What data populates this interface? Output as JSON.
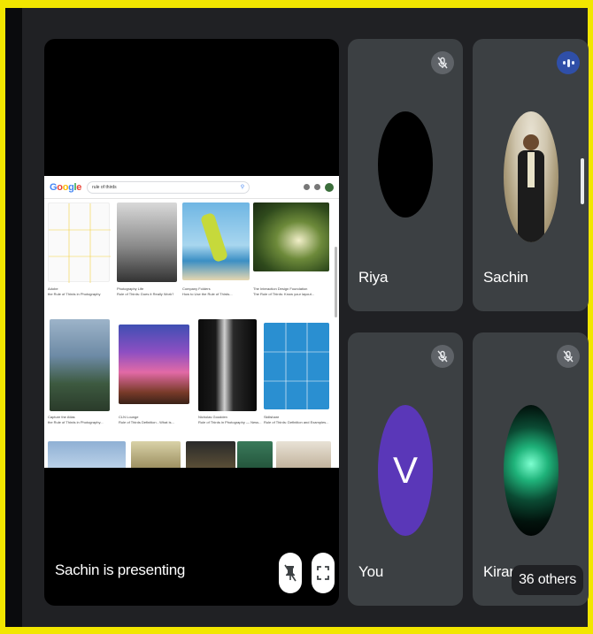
{
  "presenter_tile": {
    "caption": "Sachin is presenting",
    "unpin_icon": "pin-off-icon",
    "fullscreen_icon": "fullscreen-icon",
    "shared_screen": {
      "search_query": "rule of thirds",
      "logo": [
        "G",
        "o",
        "o",
        "g",
        "l",
        "e"
      ],
      "results": [
        {
          "source": "Adobe",
          "title": "the Rule of Thirds in Photography"
        },
        {
          "source": "Photography Life",
          "title": "Rule of Thirds: Does it Really Work?"
        },
        {
          "source": "Company Folders",
          "title": "How to Use the Rule of Thirds..."
        },
        {
          "source": "The Interaction Design Foundation",
          "title": "The Rule of Thirds: Know your layout..."
        },
        {
          "source": "Capture the Atlas",
          "title": "the Rule of Thirds in Photography..."
        },
        {
          "source": "CLN Lounge",
          "title": "Rule of Thirds Definition - What is..."
        },
        {
          "source": "Nicholas Goodden",
          "title": "Rule of Thirds in Photography — Ness..."
        },
        {
          "source": "Skillshare",
          "title": "Rule of Thirds: Definition and Examples..."
        }
      ]
    }
  },
  "participants": [
    {
      "name": "Riya",
      "muted": true
    },
    {
      "name": "Sachin",
      "muted": false,
      "speaking": true
    },
    {
      "name": "You",
      "initial": "V",
      "muted": true
    },
    {
      "name": "Kiran",
      "muted": true
    }
  ],
  "others_count_label": "36 others",
  "colors": {
    "tile_bg": "#3c4043",
    "stage_bg": "#202124",
    "you_avatar": "#5a37b8",
    "speaking_badge": "#2f4fa8",
    "frame_border": "#f2e600"
  }
}
